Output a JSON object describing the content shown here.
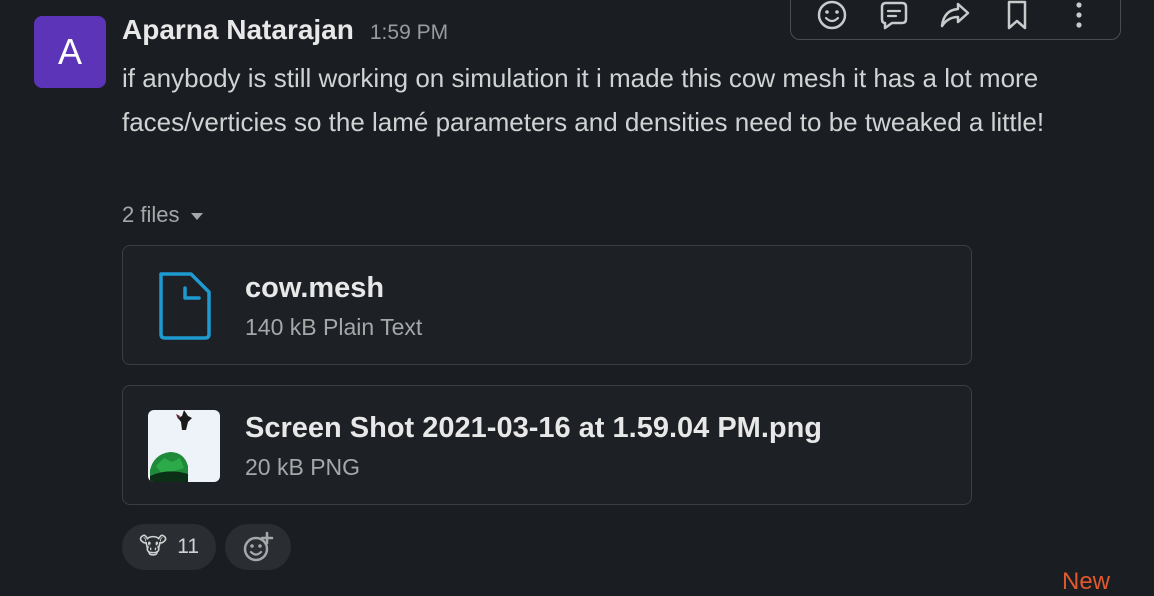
{
  "message": {
    "avatar_letter": "A",
    "sender": "Aparna Natarajan",
    "timestamp": "1:59 PM",
    "text": "if anybody is still working on simulation it i made this cow mesh it has a lot more faces/verticies so the lamé parameters and densities need to be tweaked a little!",
    "files_label": "2 files"
  },
  "files": [
    {
      "name": "cow.mesh",
      "meta": "140 kB Plain Text",
      "icon": "document-icon"
    },
    {
      "name": "Screen Shot 2021-03-16 at 1.59.04 PM.png",
      "meta": "20 kB PNG",
      "icon": "image-thumbnail"
    }
  ],
  "reactions": [
    {
      "emoji": "🐮",
      "count": "11"
    }
  ],
  "toolbar": {
    "icons": [
      "emoji-reaction-icon",
      "reply-thread-icon",
      "share-icon",
      "bookmark-icon",
      "more-actions-icon"
    ]
  },
  "new_label": "New",
  "colors": {
    "background": "#1a1d21",
    "avatar": "#5b34b8",
    "file_icon_blue": "#1d9bd1",
    "new_divider": "#e0592f"
  }
}
